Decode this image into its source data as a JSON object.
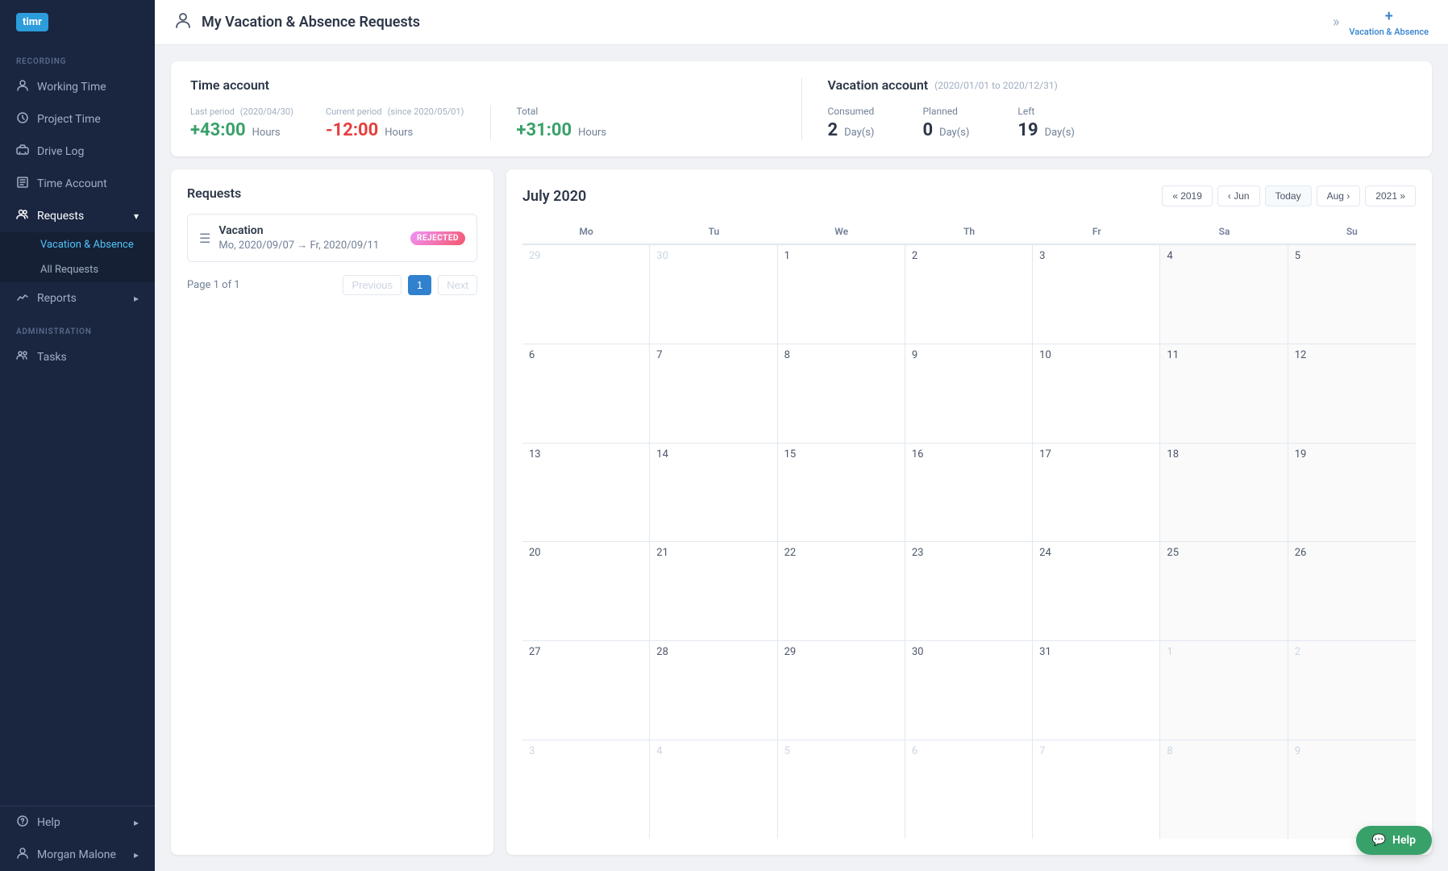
{
  "app": {
    "logo": "timr",
    "logo_color": "#2d9cdb"
  },
  "sidebar": {
    "sections": [
      {
        "label": "RECORDING",
        "items": [
          {
            "id": "working-time",
            "label": "Working Time",
            "icon": "👤",
            "active": false
          },
          {
            "id": "project-time",
            "label": "Project Time",
            "icon": "🕐",
            "active": false
          },
          {
            "id": "drive-log",
            "label": "Drive Log",
            "icon": "🚗",
            "active": false
          }
        ]
      },
      {
        "label": "",
        "items": [
          {
            "id": "time-account",
            "label": "Time Account",
            "icon": "📊",
            "active": false
          }
        ]
      },
      {
        "label": "",
        "items": [
          {
            "id": "requests",
            "label": "Requests",
            "icon": "👥",
            "active": true,
            "has_chevron": true
          }
        ]
      }
    ],
    "sub_items": [
      {
        "id": "vacation-absence",
        "label": "Vacation & Absence",
        "active": true
      },
      {
        "id": "all-requests",
        "label": "All Requests",
        "active": false
      }
    ],
    "bottom_sections": [
      {
        "label": "",
        "items": [
          {
            "id": "reports",
            "label": "Reports",
            "icon": "📈",
            "active": false,
            "has_chevron": true
          }
        ]
      }
    ],
    "admin_section": {
      "label": "ADMINISTRATION",
      "items": [
        {
          "id": "tasks",
          "label": "Tasks",
          "icon": "👥",
          "active": false
        }
      ]
    },
    "footer_items": [
      {
        "id": "help",
        "label": "Help",
        "icon": "❓",
        "has_chevron": true
      },
      {
        "id": "user",
        "label": "Morgan Malone",
        "icon": "👤",
        "has_chevron": true
      }
    ]
  },
  "header": {
    "icon": "👤",
    "title": "My Vacation & Absence Requests",
    "add_label": "Vacation & Absence",
    "plus_symbol": "+"
  },
  "time_account": {
    "title": "Time account",
    "last_period_label": "Last period",
    "last_period_date": "(2020/04/30)",
    "last_period_value": "+43:00",
    "last_period_unit": "Hours",
    "last_period_positive": true,
    "current_period_label": "Current period",
    "current_period_date": "(since 2020/05/01)",
    "current_period_value": "-12:00",
    "current_period_unit": "Hours",
    "current_period_positive": false,
    "total_label": "Total",
    "total_value": "+31:00",
    "total_unit": "Hours",
    "total_positive": true,
    "vacation_account_title": "Vacation account",
    "vacation_account_period": "(2020/01/01 to 2020/12/31)",
    "consumed_label": "Consumed",
    "consumed_value": "2",
    "consumed_unit": "Day(s)",
    "planned_label": "Planned",
    "planned_value": "0",
    "planned_unit": "Day(s)",
    "left_label": "Left",
    "left_value": "19",
    "left_unit": "Day(s)"
  },
  "requests": {
    "title": "Requests",
    "items": [
      {
        "id": "req1",
        "name": "Vacation",
        "dates": "Mo, 2020/09/07 → Fr, 2020/09/11",
        "status": "REJECTED",
        "status_type": "rejected"
      }
    ],
    "pagination": {
      "info": "Page 1 of 1",
      "previous_label": "Previous",
      "current_page": "1",
      "next_label": "Next"
    }
  },
  "calendar": {
    "month_title": "July 2020",
    "weekdays": [
      "Mo",
      "Tu",
      "We",
      "Th",
      "Fr",
      "Sa",
      "Su"
    ],
    "nav_buttons": [
      {
        "id": "prev-year",
        "label": "« 2019"
      },
      {
        "id": "prev-month",
        "label": "‹ Jun"
      },
      {
        "id": "today",
        "label": "Today"
      },
      {
        "id": "next-month",
        "label": "Aug ›"
      },
      {
        "id": "next-year",
        "label": "2021 »"
      }
    ],
    "weeks": [
      [
        {
          "day": "29",
          "other": true
        },
        {
          "day": "30",
          "other": true
        },
        {
          "day": "1"
        },
        {
          "day": "2"
        },
        {
          "day": "3"
        },
        {
          "day": "4",
          "weekend": true
        },
        {
          "day": "5",
          "weekend": true
        }
      ],
      [
        {
          "day": "6"
        },
        {
          "day": "7"
        },
        {
          "day": "8"
        },
        {
          "day": "9"
        },
        {
          "day": "10"
        },
        {
          "day": "11",
          "weekend": true
        },
        {
          "day": "12",
          "weekend": true
        }
      ],
      [
        {
          "day": "13"
        },
        {
          "day": "14"
        },
        {
          "day": "15"
        },
        {
          "day": "16"
        },
        {
          "day": "17"
        },
        {
          "day": "18",
          "weekend": true
        },
        {
          "day": "19",
          "weekend": true
        }
      ],
      [
        {
          "day": "20"
        },
        {
          "day": "21"
        },
        {
          "day": "22"
        },
        {
          "day": "23"
        },
        {
          "day": "24"
        },
        {
          "day": "25",
          "weekend": true
        },
        {
          "day": "26",
          "weekend": true
        }
      ],
      [
        {
          "day": "27"
        },
        {
          "day": "28"
        },
        {
          "day": "29"
        },
        {
          "day": "30"
        },
        {
          "day": "31"
        },
        {
          "day": "1",
          "other": true,
          "weekend": true
        },
        {
          "day": "2",
          "other": true,
          "weekend": true
        }
      ],
      [
        {
          "day": "3",
          "other": true
        },
        {
          "day": "4",
          "other": true
        },
        {
          "day": "5",
          "other": true
        },
        {
          "day": "6",
          "other": true
        },
        {
          "day": "7",
          "other": true
        },
        {
          "day": "8",
          "other": true,
          "weekend": true
        },
        {
          "day": "9",
          "other": true,
          "weekend": true
        }
      ]
    ]
  },
  "help_button": {
    "label": "Help",
    "icon": "💬"
  }
}
